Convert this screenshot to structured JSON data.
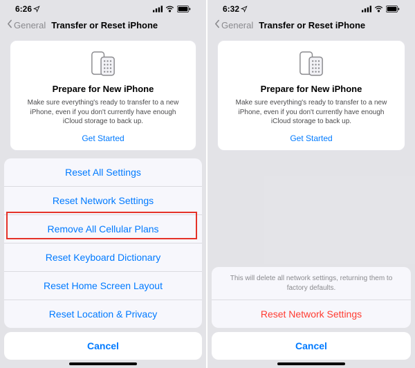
{
  "left": {
    "status": {
      "time": "6:26"
    },
    "nav": {
      "back": "General",
      "title": "Transfer or Reset iPhone"
    },
    "card": {
      "title": "Prepare for New iPhone",
      "body": "Make sure everything's ready to transfer to a new iPhone, even if you don't currently have enough iCloud storage to back up.",
      "cta": "Get Started"
    },
    "sheet": {
      "items": [
        "Reset All Settings",
        "Reset Network Settings",
        "Remove All Cellular Plans",
        "Reset Keyboard Dictionary",
        "Reset Home Screen Layout",
        "Reset Location & Privacy"
      ],
      "cancel": "Cancel"
    }
  },
  "right": {
    "status": {
      "time": "6:32"
    },
    "nav": {
      "back": "General",
      "title": "Transfer or Reset iPhone"
    },
    "card": {
      "title": "Prepare for New iPhone",
      "body": "Make sure everything's ready to transfer to a new iPhone, even if you don't currently have enough iCloud storage to back up.",
      "cta": "Get Started"
    },
    "confirm": {
      "message": "This will delete all network settings, returning them to factory defaults.",
      "action": "Reset Network Settings",
      "cancel": "Cancel"
    }
  },
  "colors": {
    "accent": "#007aff",
    "destructive": "#ff3b30",
    "highlight": "#e53228"
  }
}
